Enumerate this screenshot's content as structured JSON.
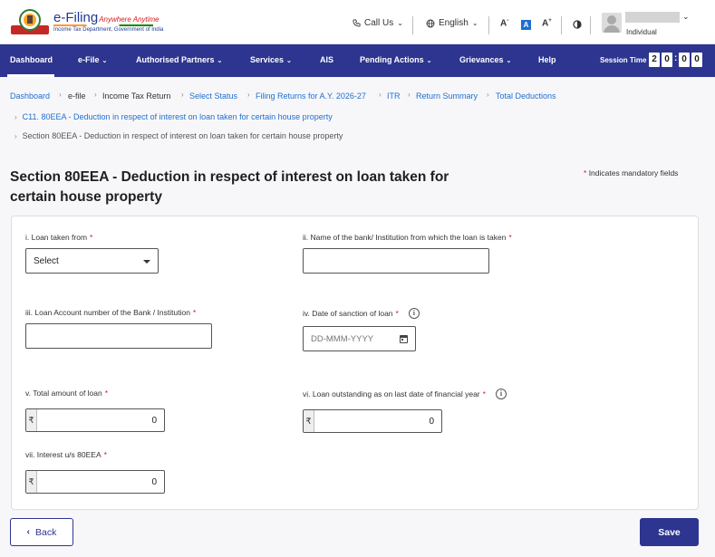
{
  "header": {
    "brand_name": "e-Filing",
    "brand_tagline": "Anywhere Anytime",
    "brand_subtitle": "Income Tax Department, Government of India",
    "call_us": "Call Us",
    "language": "English",
    "font_decrease": "A",
    "font_normal": "A",
    "font_increase": "A",
    "user_role": "Individual"
  },
  "nav": {
    "items": [
      {
        "label": "Dashboard"
      },
      {
        "label": "e-File"
      },
      {
        "label": "Authorised Partners"
      },
      {
        "label": "Services"
      },
      {
        "label": "AIS"
      },
      {
        "label": "Pending Actions"
      },
      {
        "label": "Grievances"
      },
      {
        "label": "Help"
      }
    ],
    "session_label": "Session Time",
    "session_digits": [
      "2",
      "0",
      "0",
      "0"
    ]
  },
  "breadcrumbs": {
    "row1": [
      "Dashboard",
      "e-file",
      "Income Tax Return",
      "Select Status",
      "Filing Returns for A.Y. 2026-27",
      "ITR",
      "Return Summary",
      "Total Deductions"
    ],
    "row2": "C11. 80EEA - Deduction in respect of interest on loan taken for certain house property",
    "row3": "Section 80EEA - Deduction in respect of interest on loan taken for certain house property"
  },
  "page": {
    "title": "Section 80EEA - Deduction in respect of interest on loan taken for certain house property",
    "mandatory_note": "Indicates mandatory fields",
    "asterisk": "*"
  },
  "form": {
    "loan_taken_from": {
      "label": "i. Loan taken from",
      "value": "Select"
    },
    "bank_name": {
      "label": "ii. Name of the bank/ Institution from which the loan is taken",
      "value": ""
    },
    "loan_account": {
      "label": "iii. Loan Account number of the Bank / Institution",
      "value": ""
    },
    "sanction_date": {
      "label": "iv. Date of sanction of loan",
      "placeholder": "DD-MMM-YYYY"
    },
    "total_loan": {
      "label": "v. Total amount of loan",
      "value": "0"
    },
    "loan_outstanding": {
      "label": "vi. Loan outstanding as on last date of financial year",
      "value": "0"
    },
    "interest": {
      "label": "vii. Interest u/s 80EEA",
      "value": "0"
    },
    "currency_symbol": "₹"
  },
  "actions": {
    "back": "Back",
    "save": "Save"
  },
  "colors": {
    "nav_bg": "#2d3590",
    "link": "#1f6fd1",
    "required": "#d81b1b"
  }
}
